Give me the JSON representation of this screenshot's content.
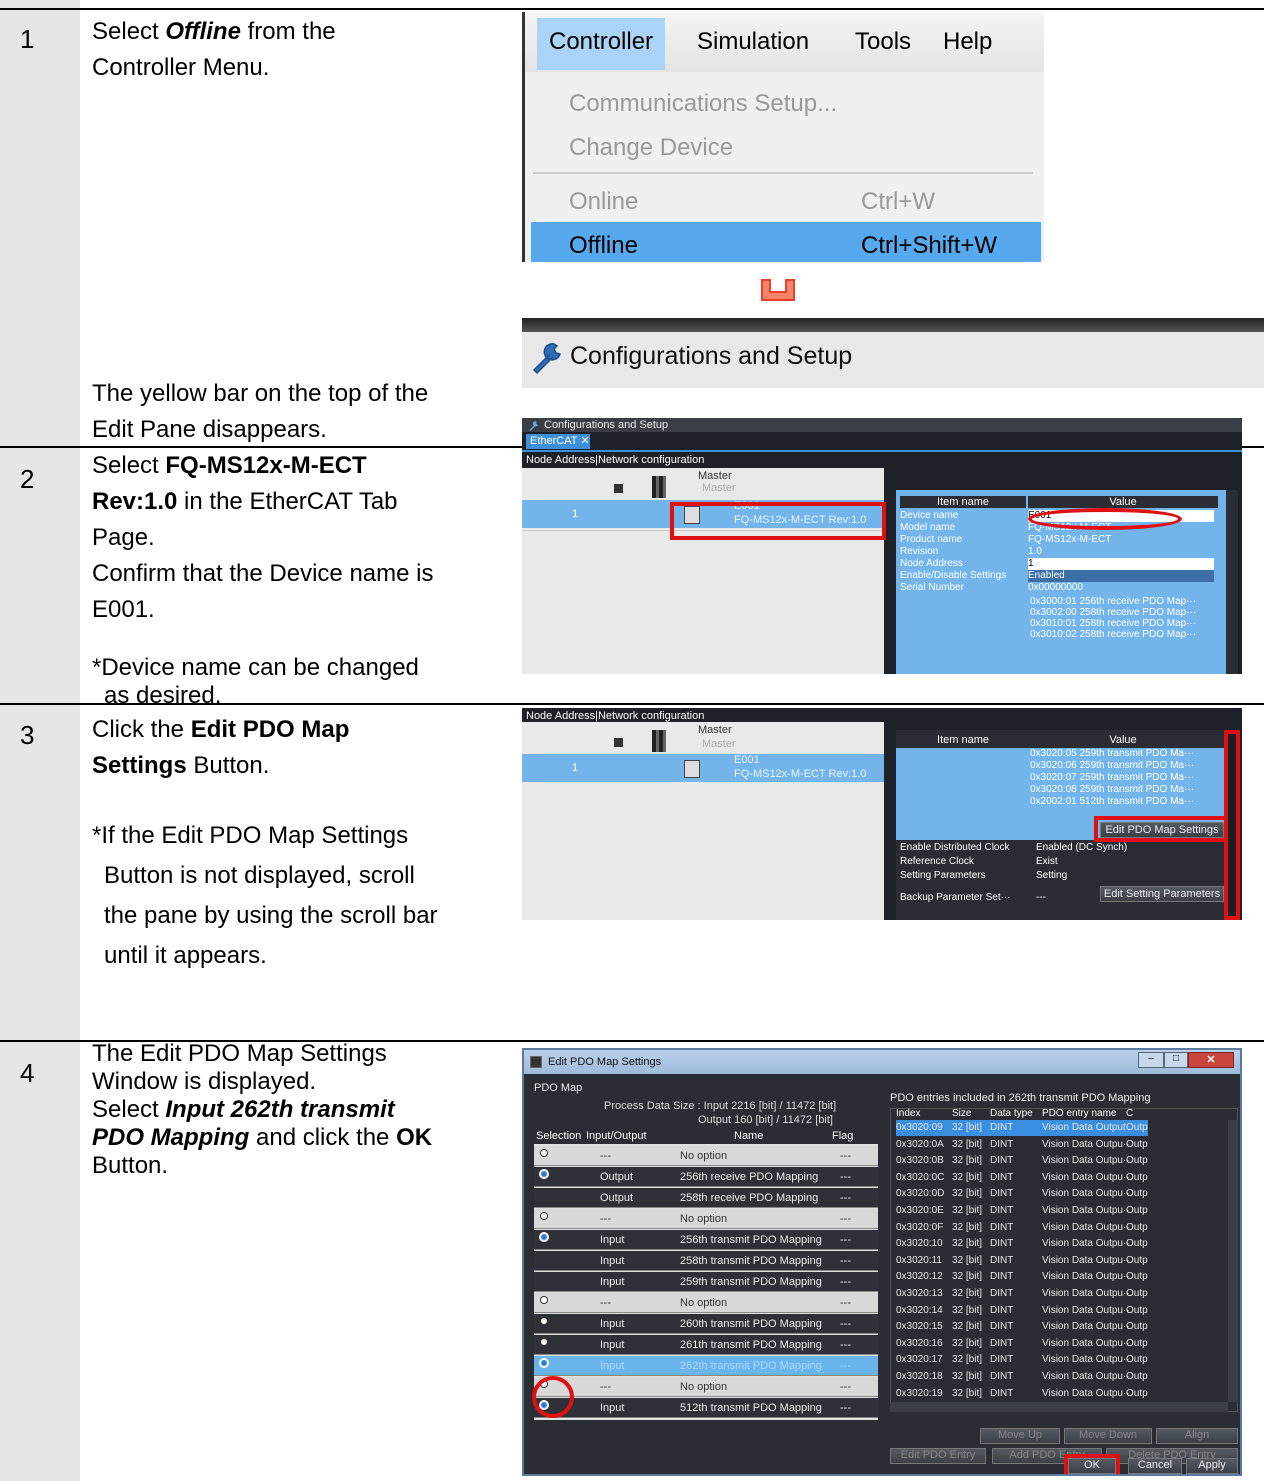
{
  "steps": [
    {
      "num": "1",
      "sel_prefix": "Select ",
      "sel_bold": "Offline",
      "sel_suffix": " from the",
      "line2": "Controller Menu.",
      "result1": "The yellow bar on the top of the",
      "result2": "Edit Pane disappears."
    },
    {
      "num": "2",
      "l1_prefix": "Select ",
      "l1_bold": "FQ-MS12x-M-ECT",
      "l2_bold": "Rev:1.0",
      "l2_suffix": " in the EtherCAT Tab",
      "l3": "Page.",
      "l4": "Confirm that the Device name is",
      "l5": "E001.",
      "note1": "*Device name can be changed",
      "note2": "as desired."
    },
    {
      "num": "3",
      "l1_prefix": "Click the ",
      "l1_bold": "Edit PDO Map",
      "l2_bold": "Settings",
      "l2_suffix": " Button.",
      "note1": "*If the Edit PDO Map Settings",
      "note2": "Button is not displayed, scroll",
      "note3": "the pane by using the scroll bar",
      "note4": "until it appears."
    },
    {
      "num": "4",
      "l1": "The Edit PDO Map Settings",
      "l2": "Window is displayed.",
      "l3_prefix": "Select ",
      "l3_bold": "Input 262th transmit",
      "l4_bold": "PDO Mapping",
      "l4_mid": " and click the ",
      "l4_bold2": "OK",
      "l5": "Button."
    }
  ],
  "menu": {
    "items": [
      "Controller",
      "Simulation",
      "Tools",
      "Help"
    ],
    "entries": [
      {
        "label": "Communications Setup...",
        "shortcut": ""
      },
      {
        "label": "Change Device",
        "shortcut": ""
      },
      {
        "label": "Online",
        "shortcut": "Ctrl+W"
      },
      {
        "label": "Offline",
        "shortcut": "Ctrl+Shift+W"
      }
    ]
  },
  "config_title": "Configurations and Setup",
  "ethercat": {
    "tab": "EtherCAT",
    "node_header": "Node Address",
    "netconf_header": "Network configuration",
    "master": "Master",
    "node_num": "1",
    "device_id": "E001",
    "device_model": "FQ-MS12x-M-ECT Rev:1.0",
    "item_name_header": "Item name",
    "value_header": "Value",
    "props": [
      {
        "name": "Device name",
        "value": "E001"
      },
      {
        "name": "Model name",
        "value": "FQ-MS12x-M-ECT"
      },
      {
        "name": "Product name",
        "value": "FQ-MS12x-M-ECT"
      },
      {
        "name": "Revision",
        "value": "1.0"
      },
      {
        "name": "Node Address",
        "value": "1"
      },
      {
        "name": "Enable/Disable Settings",
        "value": "Enabled"
      },
      {
        "name": "Serial Number",
        "value": "0x00000000"
      }
    ],
    "pdo_lines": [
      "0x3000:01 256th receive PDO Map···",
      "0x3002:00 258th receive PDO Map···",
      "0x3010:01 258th receive PDO Map···",
      "0x3010:02 258th receive PDO Map···"
    ]
  },
  "step3": {
    "pdo_lines": [
      "0x3020:05 259th transmit PDO Ma···",
      "0x3020:06 259th transmit PDO Ma···",
      "0x3020:07 259th transmit PDO Ma···",
      "0x3020:08 259th transmit PDO Ma···",
      "0x2002:01 512th transmit PDO Ma···"
    ],
    "edit_pdo_btn": "Edit PDO Map Settings",
    "props": [
      {
        "name": "Enable Distributed Clock",
        "value": "Enabled (DC Synch)"
      },
      {
        "name": "Reference Clock",
        "value": "Exist"
      },
      {
        "name": "Setting Parameters",
        "value": "Setting"
      },
      {
        "name": "Backup Parameter Set···",
        "value": "---"
      }
    ],
    "edit_setting_btn": "Edit Setting Parameters"
  },
  "pdo_window": {
    "title": "Edit PDO Map Settings",
    "pdo_map_label": "PDO Map",
    "size_line1": "Process Data Size : Input  2216 [bit]  /  11472 [bit]",
    "size_line2": "Output  160 [bit]  /  11472 [bit]",
    "col_headers": [
      "Selection",
      "Input/Output",
      "Name",
      "Flag"
    ],
    "rows": [
      {
        "sel": "dot",
        "io": "---",
        "name": "No option",
        "flag": "---"
      },
      {
        "sel": "radio",
        "io": "Output",
        "name": "256th receive PDO Mapping",
        "flag": "---"
      },
      {
        "sel": "",
        "io": "Output",
        "name": "258th receive PDO Mapping",
        "flag": "---"
      },
      {
        "sel": "dot",
        "io": "---",
        "name": "No option",
        "flag": "---"
      },
      {
        "sel": "radio",
        "io": "Input",
        "name": "256th transmit PDO Mapping",
        "flag": "---"
      },
      {
        "sel": "",
        "io": "Input",
        "name": "258th transmit PDO Mapping",
        "flag": "---"
      },
      {
        "sel": "",
        "io": "Input",
        "name": "259th transmit PDO Mapping",
        "flag": "---"
      },
      {
        "sel": "dot",
        "io": "---",
        "name": "No option",
        "flag": "---"
      },
      {
        "sel": "dot",
        "io": "Input",
        "name": "260th transmit PDO Mapping",
        "flag": "---"
      },
      {
        "sel": "dot",
        "io": "Input",
        "name": "261th transmit PDO Mapping",
        "flag": "---"
      },
      {
        "sel": "radio",
        "io": "Input",
        "name": "262th transmit PDO Mapping",
        "flag": "---"
      },
      {
        "sel": "dot",
        "io": "---",
        "name": "No option",
        "flag": "---"
      },
      {
        "sel": "radio",
        "io": "Input",
        "name": "512th transmit PDO Mapping",
        "flag": "---"
      }
    ],
    "entries_title": "PDO entries included in 262th transmit PDO Mapping",
    "entry_headers": [
      "Index",
      "Size",
      "Data type",
      "PDO entry name",
      "C"
    ],
    "entries": [
      [
        "0x3020:09",
        "32 [bit]",
        "DINT",
        "Vision Data Output9",
        "Outpu"
      ],
      [
        "0x3020:0A",
        "32 [bit]",
        "DINT",
        "Vision Data Outpu···",
        "Outpu"
      ],
      [
        "0x3020:0B",
        "32 [bit]",
        "DINT",
        "Vision Data Outpu···",
        "Outpu"
      ],
      [
        "0x3020:0C",
        "32 [bit]",
        "DINT",
        "Vision Data Outpu···",
        "Outpu"
      ],
      [
        "0x3020:0D",
        "32 [bit]",
        "DINT",
        "Vision Data Outpu···",
        "Outpu"
      ],
      [
        "0x3020:0E",
        "32 [bit]",
        "DINT",
        "Vision Data Outpu···",
        "Outpu"
      ],
      [
        "0x3020:0F",
        "32 [bit]",
        "DINT",
        "Vision Data Outpu···",
        "Outpu"
      ],
      [
        "0x3020:10",
        "32 [bit]",
        "DINT",
        "Vision Data Outpu···",
        "Outpu"
      ],
      [
        "0x3020:11",
        "32 [bit]",
        "DINT",
        "Vision Data Outpu···",
        "Outpu"
      ],
      [
        "0x3020:12",
        "32 [bit]",
        "DINT",
        "Vision Data Outpu···",
        "Outpu"
      ],
      [
        "0x3020:13",
        "32 [bit]",
        "DINT",
        "Vision Data Outpu···",
        "Outpu"
      ],
      [
        "0x3020:14",
        "32 [bit]",
        "DINT",
        "Vision Data Outpu···",
        "Outpu"
      ],
      [
        "0x3020:15",
        "32 [bit]",
        "DINT",
        "Vision Data Outpu···",
        "Outpu"
      ],
      [
        "0x3020:16",
        "32 [bit]",
        "DINT",
        "Vision Data Outpu···",
        "Outpu"
      ],
      [
        "0x3020:17",
        "32 [bit]",
        "DINT",
        "Vision Data Outpu···",
        "Outpu"
      ],
      [
        "0x3020:18",
        "32 [bit]",
        "DINT",
        "Vision Data Outpu···",
        "Outpu"
      ],
      [
        "0x3020:19",
        "32 [bit]",
        "DINT",
        "Vision Data Outpu···",
        "Outpu"
      ]
    ],
    "btn_move_up": "Move Up",
    "btn_move_down": "Move Down",
    "btn_align": "Align",
    "btn_edit_entry": "Edit PDO Entry",
    "btn_add_entry": "Add PDO Entry",
    "btn_delete_entry": "Delete PDO Entry",
    "btn_ok": "OK",
    "btn_cancel": "Cancel",
    "btn_apply": "Apply"
  }
}
